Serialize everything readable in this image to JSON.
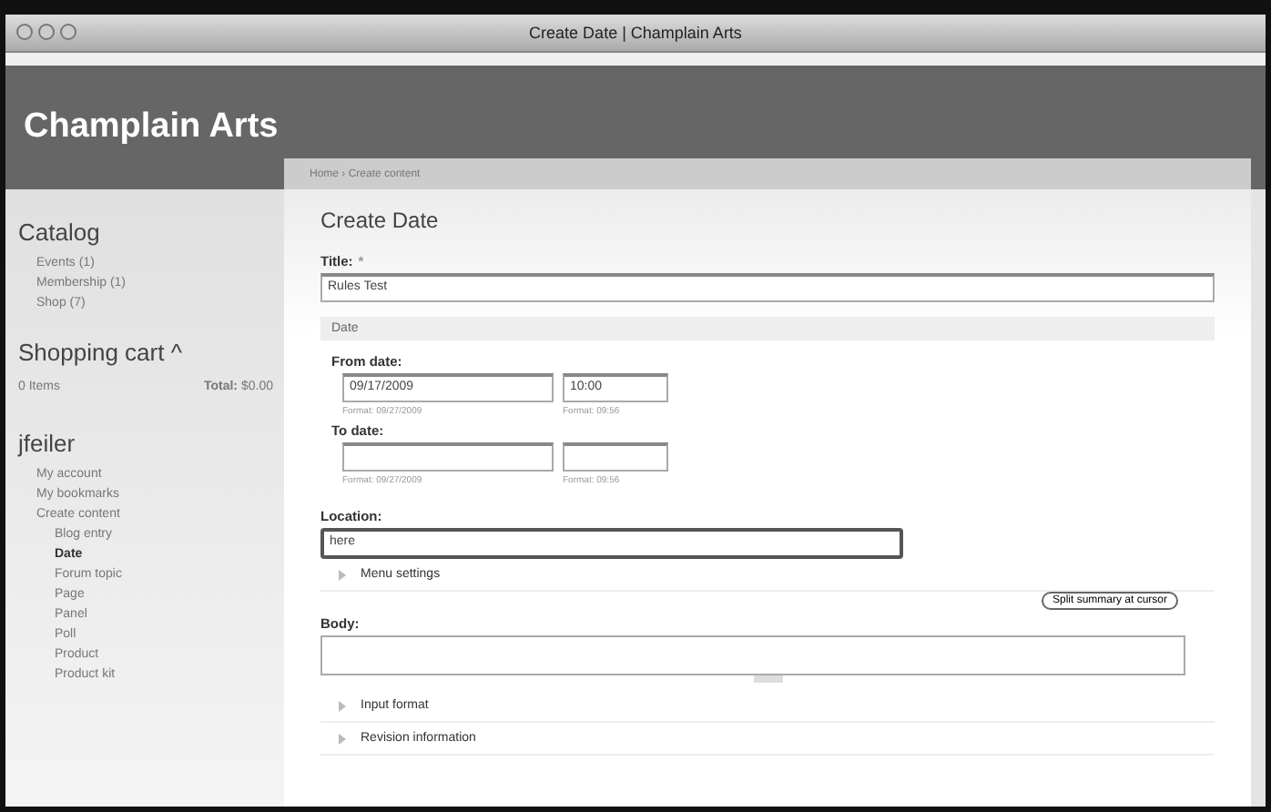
{
  "window": {
    "title": "Create Date | Champlain Arts"
  },
  "site": {
    "name": "Champlain Arts",
    "breadcrumb": "Home › Create content"
  },
  "sidebar": {
    "catalog": {
      "title": "Catalog",
      "items": [
        "Events (1)",
        "Membership (1)",
        "Shop (7)"
      ]
    },
    "cart": {
      "title": "Shopping cart",
      "toggle": "^",
      "items": "0 Items",
      "total_label": "Total:",
      "total": "$0.00"
    },
    "user": {
      "title": "jfeiler",
      "items": [
        {
          "label": "My account",
          "selected": false
        },
        {
          "label": "My bookmarks",
          "selected": false
        },
        {
          "label": "Create content",
          "selected": false,
          "children": [
            {
              "label": "Blog entry",
              "selected": false
            },
            {
              "label": "Date",
              "selected": true
            },
            {
              "label": "Forum topic",
              "selected": false
            },
            {
              "label": "Page",
              "selected": false
            },
            {
              "label": "Panel",
              "selected": false
            },
            {
              "label": "Poll",
              "selected": false
            },
            {
              "label": "Product",
              "selected": false
            },
            {
              "label": "Product kit",
              "selected": false
            }
          ]
        }
      ]
    }
  },
  "form": {
    "heading": "Create Date",
    "title": {
      "label": "Title:",
      "required": "*",
      "value": "Rules Test"
    },
    "date_group": {
      "legend": "Date",
      "from": {
        "label": "From date:",
        "date": "09/17/2009",
        "time": "10:00",
        "date_hint": "Format: 09/27/2009",
        "time_hint": "Format: 09:56"
      },
      "to": {
        "label": "To date:",
        "date_hint": "Format: 09/27/2009",
        "time_hint": "Format: 09:56"
      }
    },
    "location": {
      "label": "Location:",
      "value": "here"
    },
    "sections_top": [
      {
        "label": "Menu settings",
        "expanded": false
      }
    ],
    "split_button": "Split summary at cursor",
    "body": {
      "label": "Body:"
    },
    "sections_bottom": [
      {
        "label": "Input format",
        "expanded": false
      },
      {
        "label": "Revision information",
        "expanded": false
      }
    ]
  }
}
